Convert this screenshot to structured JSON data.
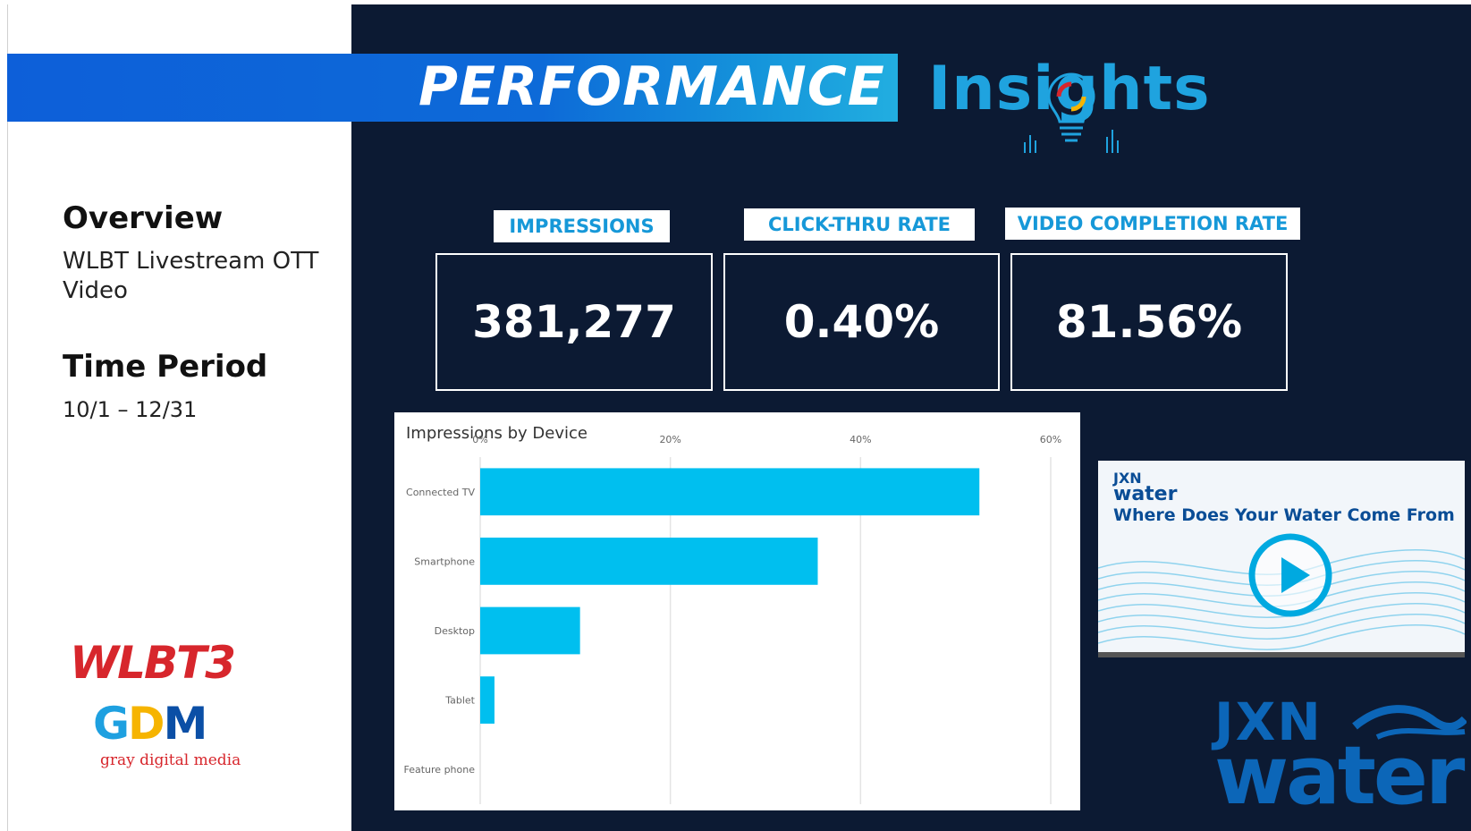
{
  "header": {
    "title": "PERFORMANCE",
    "insights": "Insights"
  },
  "sidebar": {
    "overview_heading": "Overview",
    "overview_value": "WLBT Livestream OTT Video",
    "period_heading": "Time Period",
    "period_value": "10/1 – 12/31"
  },
  "logos": {
    "wlbt": "WLBT3",
    "gdm_g": "G",
    "gdm_d": "D",
    "gdm_m": "M",
    "gdm_sub": "gray digital media",
    "jxn_top": "JXN",
    "jxn_bottom": "water"
  },
  "kpis": [
    {
      "label": "IMPRESSIONS",
      "value": "381,277"
    },
    {
      "label": "CLICK-THRU RATE",
      "value": "0.40%"
    },
    {
      "label": "VIDEO COMPLETION RATE",
      "value": "81.56%"
    }
  ],
  "video": {
    "brand_top": "JXN",
    "brand_bottom": "water",
    "title": "Where Does Your Water Come From"
  },
  "colors": {
    "dark_bg": "#0c1a33",
    "accent_blue": "#1698d8",
    "bar": "#00bfef",
    "brand_red": "#d7262c"
  },
  "chart_data": {
    "type": "bar",
    "orientation": "horizontal",
    "title": "Impressions by Device",
    "categories": [
      "Connected TV",
      "Smartphone",
      "Desktop",
      "Tablet",
      "Feature phone"
    ],
    "values": [
      52.5,
      35.5,
      10.5,
      1.5,
      0
    ],
    "xlim": [
      0,
      60
    ],
    "ticks": [
      0,
      20,
      40,
      60
    ],
    "tick_labels": [
      "0%",
      "20%",
      "40%",
      "60%"
    ],
    "grid": true
  }
}
